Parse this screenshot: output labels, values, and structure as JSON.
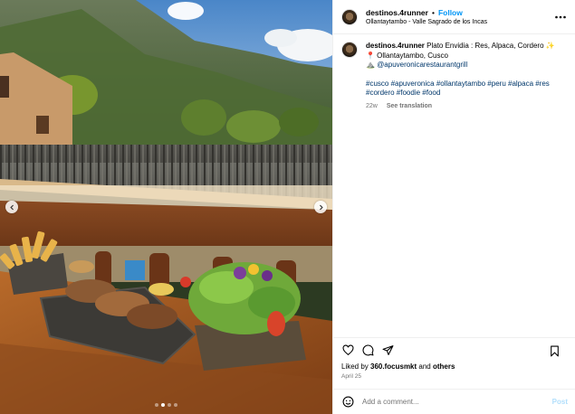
{
  "post": {
    "username": "destinos.4runner",
    "separator": "•",
    "follow_label": "Follow",
    "location": "Ollantaytambo - Valle Sagrado de los Incas",
    "more_icon": "more-horizontal-icon"
  },
  "media": {
    "prev_icon": "chevron-left-icon",
    "next_icon": "chevron-right-icon",
    "slide_count": 4,
    "active_slide": 1
  },
  "caption": {
    "username": "destinos.4runner",
    "line1": "Plato Envidia : Res, Alpaca, Cordero ✨",
    "line2": "📍 Ollantaytambo, Cusco",
    "line3_prefix": "⛰️ ",
    "mention": "@apuveronicarestaurantgrill",
    "hashtags_line1": "#cusco #apuveronica #ollantaytambo #peru #alpaca #res",
    "hashtags_line2": "#cordero #foodie #food",
    "age": "22w",
    "see_translation": "See translation"
  },
  "actions": {
    "like_icon": "heart-icon",
    "comment_icon": "comment-icon",
    "share_icon": "share-icon",
    "save_icon": "bookmark-icon"
  },
  "likes": {
    "prefix": "Liked by ",
    "user": "360.focusmkt",
    "middle": " and ",
    "others": "others"
  },
  "date": "April 25",
  "comment": {
    "emoji_icon": "emoji-icon",
    "placeholder": "Add a comment...",
    "post_label": "Post"
  },
  "colors": {
    "link": "#00376b",
    "follow": "#0095f6",
    "post_disabled": "#b2dffc",
    "muted": "#737373"
  }
}
